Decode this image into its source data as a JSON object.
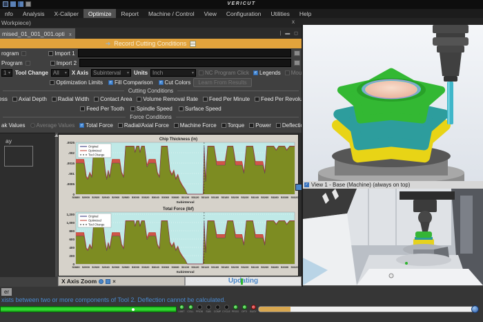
{
  "window": {
    "title": "VERICUT"
  },
  "menu": {
    "items": [
      {
        "label": "nfo",
        "active": false
      },
      {
        "label": "Analysis",
        "active": false
      },
      {
        "label": "X-Caliper",
        "active": false
      },
      {
        "label": "Optimize",
        "active": true
      },
      {
        "label": "Report",
        "active": false
      },
      {
        "label": "Machine / Control",
        "active": false
      },
      {
        "label": "View",
        "active": false
      },
      {
        "label": "Configuration",
        "active": false
      },
      {
        "label": "Utilities",
        "active": false
      },
      {
        "label": "Help",
        "active": false
      }
    ]
  },
  "subheader": {
    "text": "Workpiece)",
    "close": "x"
  },
  "opti_tab": {
    "label": "mised_01_001_001.opti",
    "close": "x"
  },
  "banner": {
    "label": "Record Cutting Conditions"
  },
  "form": {
    "row1": {
      "label": "rogram",
      "import_label": "Import 1"
    },
    "row2": {
      "label": "Program",
      "import_label": "Import 2"
    },
    "row3": {
      "tool_select_value": "1",
      "tool_change_label": "Tool Change",
      "tool_change_value": "All",
      "x_axis_label": "X Axis",
      "x_axis_value": "Subinterval",
      "units_label": "Units",
      "units_value": "Inch",
      "checks": [
        {
          "label": "NC Program Click",
          "state": "dim"
        },
        {
          "label": "Legends",
          "state": "on"
        },
        {
          "label": "Mouse Followers",
          "state": "dim"
        }
      ]
    },
    "row4": {
      "checks": [
        {
          "label": "Optimization Limits",
          "state": "off"
        },
        {
          "label": "Fill Comparison",
          "state": "on"
        },
        {
          "label": "Cut Colors",
          "state": "on"
        }
      ],
      "button": "Learn From Results"
    },
    "cutting": {
      "title": "Cutting Conditions",
      "row1": [
        {
          "label": "ckness",
          "state": "off",
          "nobox": true
        },
        {
          "label": "Axial Depth",
          "state": "off"
        },
        {
          "label": "Radial Width",
          "state": "off"
        },
        {
          "label": "Contact Area",
          "state": "off"
        },
        {
          "label": "Volume Removal Rate",
          "state": "off"
        },
        {
          "label": "Feed Per Minute",
          "state": "off"
        },
        {
          "label": "Feed Per Revolution",
          "state": "off"
        }
      ],
      "row2": [
        {
          "label": "Feed Per Tooth",
          "state": "off"
        },
        {
          "label": "Spindle Speed",
          "state": "off"
        },
        {
          "label": "Surface Speed",
          "state": "off"
        }
      ]
    },
    "force": {
      "title": "Force Conditions",
      "items": [
        {
          "label": "ak Values",
          "state": "off",
          "nobox": true
        },
        {
          "label": "Average Values",
          "state": "dim",
          "type": "radio"
        },
        {
          "label": "Total Force",
          "state": "on"
        },
        {
          "label": "Radial/Axial Force",
          "state": "off"
        },
        {
          "label": "Machine Force",
          "state": "off"
        },
        {
          "label": "Torque",
          "state": "off"
        },
        {
          "label": "Power",
          "state": "off"
        },
        {
          "label": "Deflection",
          "state": "off"
        }
      ]
    }
  },
  "charts_sidebar": {
    "label": "ay"
  },
  "chart_footer": {
    "zoom_label": "X Axis Zoom",
    "updating_label": "Updating"
  },
  "chart_data": [
    {
      "type": "area",
      "title": "Chip Thickness (in)",
      "xlabel": "Subinterval",
      "ylim": [
        0,
        0.0025
      ],
      "yticks": [
        {
          "v": 0.0025,
          "label": ".0025"
        },
        {
          "v": 0.002,
          "label": ".002"
        },
        {
          "v": 0.0015,
          "label": ".0015"
        },
        {
          "v": 0.001,
          "label": ".001"
        },
        {
          "v": 0.0005,
          "label": ".0005"
        },
        {
          "v": 0,
          "label": "0"
        }
      ],
      "xticks": [
        "52880",
        "52900",
        "52920",
        "52940",
        "52960",
        "52980",
        "53000",
        "53020",
        "53040",
        "53060",
        "53080",
        "53100",
        "53120",
        "53140",
        "53160",
        "53180",
        "53200",
        "53220",
        "53240",
        "53260",
        "53280",
        "53300",
        "53320"
      ],
      "x": [
        52880,
        52896,
        52901,
        52904,
        52908,
        52912,
        52916,
        52934,
        52939,
        52942,
        52945,
        52948,
        52953,
        52968,
        52972,
        52976,
        52980,
        52997,
        52999,
        53002,
        53007,
        53009,
        53012,
        53018,
        53023,
        53027,
        53040,
        53044,
        53048,
        53052,
        53064,
        53069,
        53073,
        53077,
        53081,
        53085,
        53089,
        53094,
        53100,
        53104,
        53136,
        53138,
        53141,
        53145,
        53158,
        53163,
        53180,
        53185,
        53196,
        53201,
        53214,
        53218,
        53223,
        53236,
        53241,
        53256,
        53260,
        53264,
        53278,
        53283,
        53288,
        53300,
        53304,
        53310,
        53320
      ],
      "series": [
        {
          "name": "Original",
          "color": "#2b2b7a",
          "values": [
            0.0015,
            0.0015,
            0.0008,
            0.0007,
            0.001,
            0.0008,
            0.0023,
            0.0023,
            0.0011,
            0.0007,
            0.0011,
            0.0008,
            0.0015,
            0.0015,
            0.001,
            0.0008,
            0.0023,
            0.0023,
            0.002,
            0.0023,
            0.0023,
            0.002,
            0.0023,
            0.0023,
            0.0013,
            0.0015,
            0.0015,
            0.001,
            0.0008,
            0.0023,
            0.0023,
            0.0011,
            0.0009,
            0.0011,
            0.0007,
            0.0009,
            0.0006,
            0.0004,
            0.0002,
            0,
            0,
            0.0023,
            0.0006,
            0.0023,
            0.0023,
            0.0014,
            0.0014,
            0.0023,
            0.0023,
            0.0014,
            0.0014,
            0.001,
            0.0023,
            0.0023,
            0.0014,
            0.0014,
            0.001,
            0.0023,
            0.0023,
            0.0021,
            0.0023,
            0.0023,
            0.0021,
            0.0023,
            0.0023
          ]
        },
        {
          "name": "Optimized",
          "color": "#c03a2e",
          "values": [
            0.00168,
            0.00168,
            0.00086,
            0.00076,
            0.00106,
            0.00086,
            0.00232,
            0.00232,
            0.00118,
            0.00076,
            0.00116,
            0.00086,
            0.00168,
            0.00168,
            0.00106,
            0.00086,
            0.00232,
            0.00232,
            0.00204,
            0.00232,
            0.00232,
            0.00204,
            0.00232,
            0.00232,
            0.0014,
            0.00168,
            0.00168,
            0.00106,
            0.00086,
            0.00232,
            0.00232,
            0.00118,
            0.00096,
            0.00116,
            0.00076,
            0.00096,
            0.00066,
            0.00044,
            0.00022,
            0,
            0,
            0.0023,
            0.00064,
            0.00232,
            0.00232,
            0.00158,
            0.00158,
            0.00232,
            0.00232,
            0.00158,
            0.00158,
            0.00106,
            0.00232,
            0.00232,
            0.00158,
            0.00158,
            0.00106,
            0.00232,
            0.00232,
            0.00214,
            0.00232,
            0.00232,
            0.00214,
            0.00232,
            0.00232
          ]
        }
      ],
      "tool_changes": [
        53138
      ],
      "legend": [
        {
          "label": "Original",
          "color": "#2b2b7a",
          "dash": ""
        },
        {
          "label": "Optimized",
          "color": "#c03a2e",
          "dash": ""
        },
        {
          "label": "Tool Change",
          "color": "#222222",
          "dash": "2,2"
        }
      ],
      "fills": {
        "original": "#7d8c22",
        "optimized": "#d05548"
      },
      "plot_bg": "#bfe9e7"
    },
    {
      "type": "area",
      "title": "Total Force (lbf)",
      "xlabel": "Subinterval",
      "ylim": [
        0,
        1250
      ],
      "yticks": [
        {
          "v": 1200,
          "label": "1,200"
        },
        {
          "v": 1000,
          "label": "1,000"
        },
        {
          "v": 800,
          "label": "800"
        },
        {
          "v": 600,
          "label": "600"
        },
        {
          "v": 400,
          "label": "400"
        },
        {
          "v": 200,
          "label": "200"
        },
        {
          "v": 0,
          "label": "0"
        }
      ],
      "xticks": [
        "52880",
        "52900",
        "52920",
        "52940",
        "52960",
        "52980",
        "53000",
        "53020",
        "53040",
        "53060",
        "53080",
        "53100",
        "53120",
        "53140",
        "53160",
        "53180",
        "53200",
        "53220",
        "53240",
        "53260",
        "53280",
        "53300",
        "53320"
      ],
      "x": [
        52880,
        52896,
        52901,
        52904,
        52908,
        52912,
        52916,
        52934,
        52939,
        52942,
        52945,
        52948,
        52953,
        52968,
        52972,
        52976,
        52980,
        52997,
        52999,
        53002,
        53007,
        53009,
        53012,
        53018,
        53023,
        53027,
        53040,
        53044,
        53048,
        53052,
        53064,
        53069,
        53073,
        53077,
        53081,
        53085,
        53089,
        53094,
        53100,
        53104,
        53136,
        53138,
        53141,
        53145,
        53158,
        53163,
        53180,
        53185,
        53196,
        53201,
        53214,
        53218,
        53223,
        53236,
        53241,
        53256,
        53260,
        53264,
        53278,
        53283,
        53288,
        53300,
        53304,
        53310,
        53320
      ],
      "series": [
        {
          "name": "Original",
          "color": "#2b2b7a",
          "values": [
            675,
            675,
            360,
            315,
            450,
            360,
            1035,
            1035,
            495,
            315,
            495,
            360,
            675,
            675,
            450,
            360,
            1035,
            1035,
            900,
            1035,
            1035,
            900,
            1035,
            1035,
            585,
            675,
            675,
            450,
            360,
            1035,
            1035,
            495,
            405,
            495,
            315,
            405,
            270,
            180,
            90,
            0,
            0,
            1035,
            270,
            1035,
            1035,
            630,
            630,
            1035,
            1035,
            630,
            630,
            450,
            1035,
            1035,
            630,
            630,
            450,
            1035,
            1035,
            945,
            1035,
            1035,
            945,
            1035,
            1035
          ]
        },
        {
          "name": "Optimized",
          "color": "#c03a2e",
          "values": [
            756,
            756,
            387,
            342,
            477,
            387,
            1044,
            1044,
            531,
            342,
            522,
            387,
            756,
            756,
            477,
            387,
            1044,
            1044,
            918,
            1044,
            1044,
            918,
            1044,
            1044,
            630,
            756,
            756,
            477,
            387,
            1044,
            1044,
            531,
            432,
            522,
            342,
            432,
            297,
            198,
            99,
            0,
            0,
            1035,
            288,
            1044,
            1044,
            711,
            711,
            1044,
            1044,
            711,
            711,
            477,
            1044,
            1044,
            711,
            711,
            477,
            1044,
            1044,
            963,
            1044,
            1044,
            963,
            1044,
            1044
          ]
        }
      ],
      "tool_changes": [
        53138
      ],
      "legend": [
        {
          "label": "Original",
          "color": "#2b2b7a",
          "dash": ""
        },
        {
          "label": "Optimized",
          "color": "#c03a2e",
          "dash": ""
        },
        {
          "label": "Tool Change",
          "color": "#222222",
          "dash": "2,2"
        }
      ],
      "fills": {
        "original": "#7d8c22",
        "optimized": "#d05548"
      },
      "plot_bg": "#bfe9e7"
    }
  ],
  "view1": {
    "title": "View 1 - Base (Machine) (always on top)"
  },
  "status": {
    "tab": "er",
    "message": "xists between two or more components of Tool 2. Deflection cannot be calculated.",
    "leds": [
      {
        "label": "LIMIT",
        "state": "green"
      },
      {
        "label": "COLL",
        "state": "green"
      },
      {
        "label": "PROB",
        "state": "off"
      },
      {
        "label": "SUB",
        "state": "off"
      },
      {
        "label": "COMP",
        "state": "off"
      },
      {
        "label": "CYCLE",
        "state": "off"
      },
      {
        "label": "PROG",
        "state": "green"
      },
      {
        "label": "OPTI",
        "state": "green"
      },
      {
        "label": "BUSY",
        "state": "red"
      }
    ]
  },
  "colors": {
    "banner": "#e2a33c",
    "chart_plot_bg": "#bfe9e7",
    "fill_original": "#7d8c22",
    "fill_optimized": "#d05548",
    "progress_green": "#3ae43a",
    "scroll_orange": "#d9a850",
    "message_blue": "#4a8ad0"
  }
}
